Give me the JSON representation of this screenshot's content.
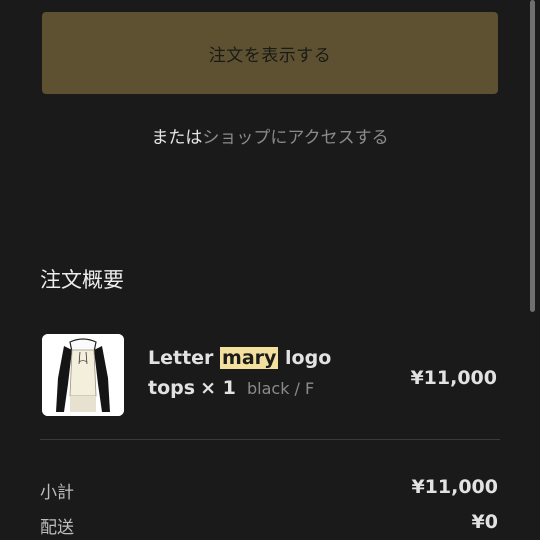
{
  "order_button": {
    "label": "注文を表示する"
  },
  "shop_prompt": {
    "prefix": "または",
    "link": "ショップにアクセスする"
  },
  "summary": {
    "title": "注文概要",
    "item": {
      "name_before": "Letter ",
      "name_highlight": "mary",
      "name_after": " logo",
      "type": "tops",
      "quantity": "× 1",
      "variant": "black / F",
      "price": "¥11,000",
      "thumbnail_icon": "product-image"
    },
    "subtotal_label": "小計",
    "subtotal_value": "¥11,000",
    "shipping_label": "配送",
    "shipping_value": "¥0"
  },
  "colors": {
    "background": "#1a1a1a",
    "button": "#5e5131",
    "highlight": "#f3df9e",
    "muted": "#8a8a8a"
  }
}
